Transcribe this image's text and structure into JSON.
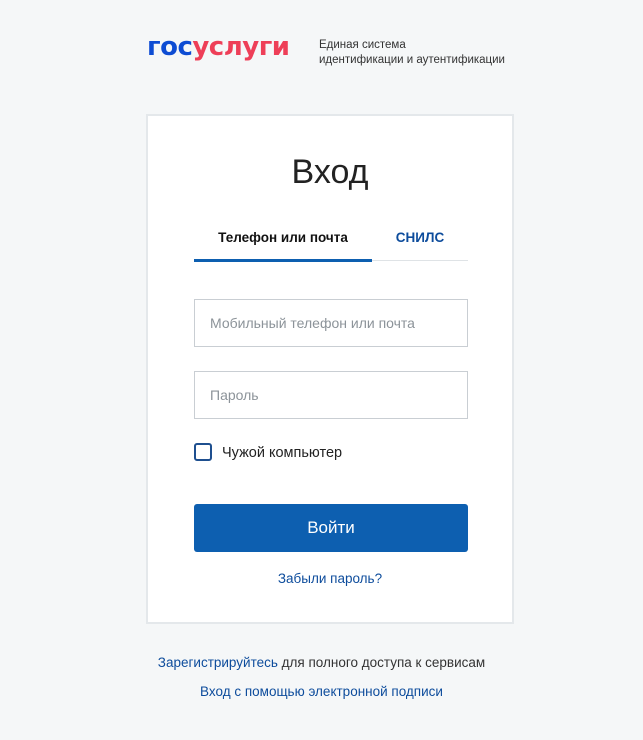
{
  "header": {
    "logo_part1": "гос",
    "logo_part2": "услуги",
    "subtitle_line1": "Единая система",
    "subtitle_line2": "идентификации и аутентификации"
  },
  "login": {
    "title": "Вход",
    "tabs": [
      {
        "label": "Телефон или почта",
        "active": true
      },
      {
        "label": "СНИЛС",
        "active": false
      }
    ],
    "login_field": {
      "value": "",
      "placeholder": "Мобильный телефон или почта"
    },
    "password_field": {
      "value": "",
      "placeholder": "Пароль"
    },
    "foreign_computer": {
      "label": "Чужой компьютер",
      "checked": false
    },
    "submit_label": "Войти",
    "forgot_label": "Забыли пароль?"
  },
  "footer": {
    "register_link": "Зарегистрируйтесь",
    "register_text": " для полного доступа к сервисам",
    "esign_link": "Вход с помощью электронной подписи"
  },
  "colors": {
    "brand_blue": "#0d4cd3",
    "brand_red": "#ee3f58",
    "button": "#0d5fb0",
    "link": "#0d4c9c",
    "background": "#f5f7f8"
  }
}
